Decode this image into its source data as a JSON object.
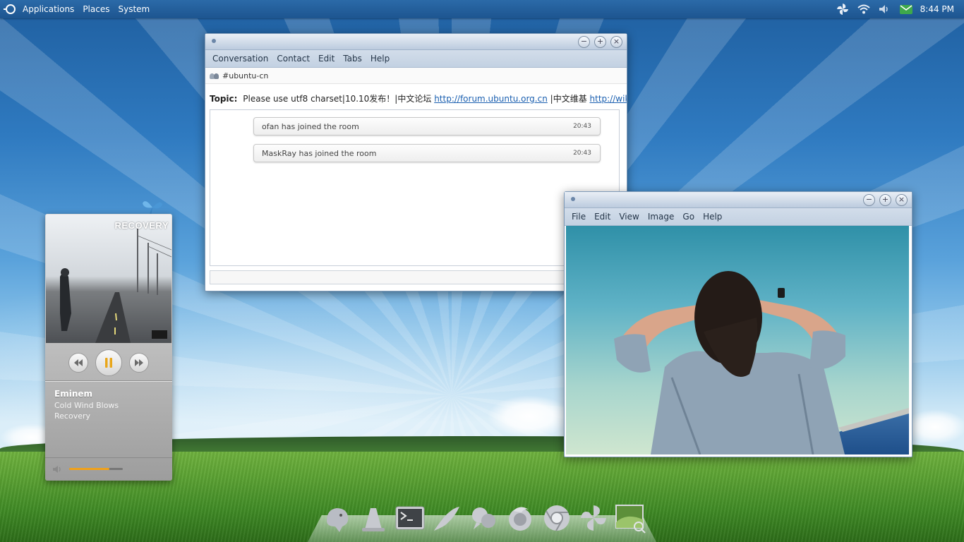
{
  "top_panel": {
    "menus": [
      "Applications",
      "Places",
      "System"
    ],
    "clock": "8:44 PM"
  },
  "chat_window": {
    "menu": [
      "Conversation",
      "Contact",
      "Edit",
      "Tabs",
      "Help"
    ],
    "tab": "#ubuntu-cn",
    "topic_label": "Topic:",
    "topic_text_1": "Please use utf8 charset|10.10发布！|中文论坛",
    "topic_link_1": "http://forum.ubuntu.org.cn",
    "topic_text_2": "|中文维基",
    "topic_link_2": "http://wiki.u…",
    "messages": [
      {
        "text": "ofan has joined the room",
        "time": "20:43"
      },
      {
        "text": "MaskRay has joined the room",
        "time": "20:43"
      }
    ]
  },
  "viewer_window": {
    "menu": [
      "File",
      "Edit",
      "View",
      "Image",
      "Go",
      "Help"
    ]
  },
  "player": {
    "cover_title": "RECOVERY",
    "artist": "Eminem",
    "track": "Cold Wind Blows",
    "album": "Recovery",
    "state": "playing",
    "volume": 0.75
  },
  "dock": {
    "items": [
      "pidgin-icon",
      "vlc-icon",
      "terminal-icon",
      "inkscape-icon",
      "empathy-icon",
      "firefox-icon",
      "chrome-icon",
      "settings-icon",
      "image-viewer-icon"
    ]
  },
  "colors": {
    "panel": "#1d5590",
    "accent_volume": "#f0a11a",
    "link": "#1a5fb0"
  }
}
